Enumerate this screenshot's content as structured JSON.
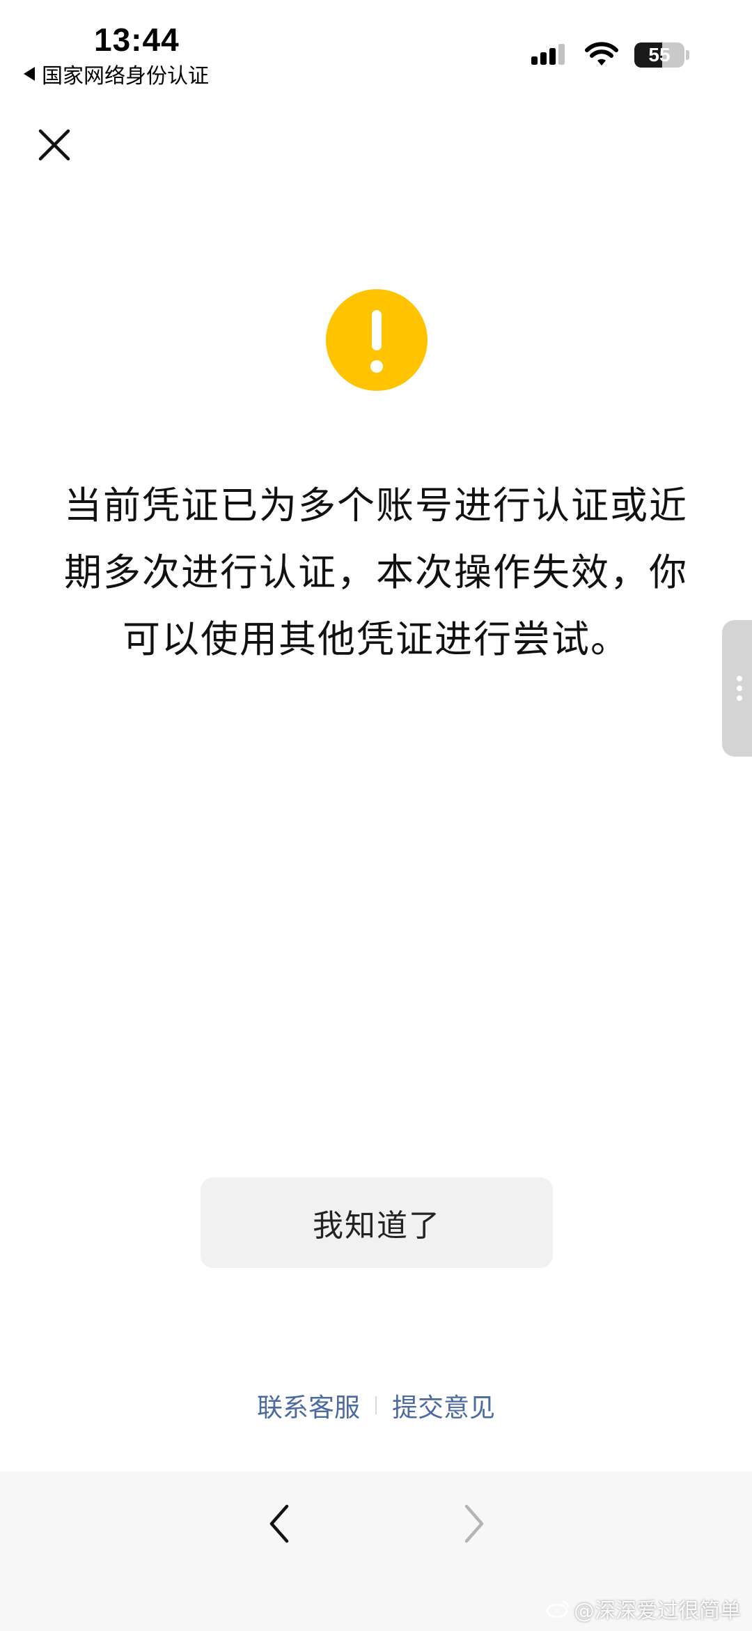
{
  "status_bar": {
    "time": "13:44",
    "back_app": "国家网络身份认证",
    "battery": "55"
  },
  "dialog": {
    "message": "当前凭证已为多个账号进行认证或近期多次进行认证，本次操作失效，你可以使用其他凭证进行尝试。",
    "primary_button": "我知道了",
    "links": {
      "contact": "联系客服",
      "feedback": "提交意见"
    }
  },
  "watermark": "@深深爱过很简单",
  "colors": {
    "warning": "#FFC300",
    "link": "#4b6a9f"
  },
  "icons": {
    "close": "close-icon",
    "warning": "exclamation-icon",
    "back": "chevron-left-icon",
    "forward": "chevron-right-icon"
  }
}
